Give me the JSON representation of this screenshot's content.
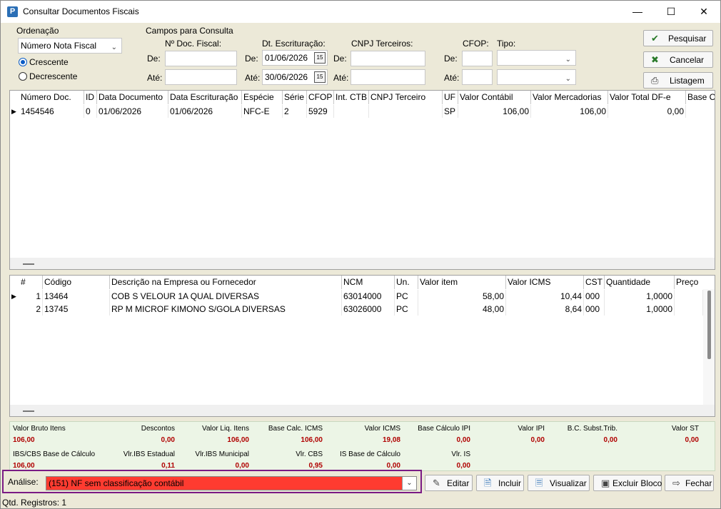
{
  "window": {
    "title": "Consultar Documentos Fiscais",
    "app_icon_letter": "P",
    "minimize": "—",
    "maximize": "☐",
    "close": "✕"
  },
  "ordenacao": {
    "label": "Ordenação",
    "selected": "Número Nota Fiscal",
    "crescente": "Crescente",
    "decrescente": "Decrescente"
  },
  "campos": {
    "title": "Campos para Consulta",
    "nro_doc_label": "Nº Doc. Fiscal:",
    "dt_escrit_label": "Dt. Escrituração:",
    "cnpj_label": "CNPJ Terceiros:",
    "cfop_label": "CFOP:",
    "tipo_label": "Tipo:",
    "de": "De:",
    "ate": "Até:",
    "dt_de_value": "01/06/2026",
    "dt_ate_value": "30/06/2026",
    "nro_de_value": "",
    "nro_ate_value": "",
    "cnpj_de_value": "",
    "cnpj_ate_value": "",
    "cfop_de_value": "",
    "cfop_ate_value": "",
    "tipo_de_value": "",
    "tipo_ate_value": ""
  },
  "actions": {
    "pesquisar": "Pesquisar",
    "cancelar": "Cancelar",
    "listagem": "Listagem"
  },
  "documents": {
    "columns": [
      "Número Doc.",
      "ID",
      "Data Documento",
      "Data Escrituração",
      "Espécie",
      "Série",
      "CFOP",
      "Int. CTB",
      "CNPJ Terceiro",
      "UF",
      "Valor Contábil",
      "Valor Mercadorias",
      "Valor Total DF-e",
      "Base C"
    ],
    "rows": [
      [
        "1454546",
        "0",
        "01/06/2026",
        "01/06/2026",
        "NFC-E",
        "2",
        "5929",
        "",
        "",
        "SP",
        "106,00",
        "106,00",
        "0,00",
        ""
      ]
    ]
  },
  "items": {
    "columns": [
      "#",
      "Código",
      "Descrição na Empresa ou Fornecedor",
      "NCM",
      "Un.",
      "Valor item",
      "Valor ICMS",
      "CST",
      "Quantidade",
      "Preço"
    ],
    "rows": [
      [
        "1",
        "13464",
        "COB S VELOUR 1A QUAL DIVERSAS",
        "63014000",
        "PC",
        "58,00",
        "10,44",
        "000",
        "1,0000",
        ""
      ],
      [
        "2",
        "13745",
        "RP M MICROF KIMONO S/GOLA DIVERSAS",
        "63026000",
        "PC",
        "48,00",
        "8,64",
        "000",
        "1,0000",
        ""
      ]
    ]
  },
  "totals": {
    "row1": [
      {
        "label": "Valor Bruto Itens",
        "value": "106,00"
      },
      {
        "label": "Descontos",
        "value": "0,00"
      },
      {
        "label": "Valor Liq. Itens",
        "value": "106,00"
      },
      {
        "label": "Base Calc. ICMS",
        "value": "106,00"
      },
      {
        "label": "Valor ICMS",
        "value": "19,08"
      },
      {
        "label": "Base Cálculo IPI",
        "value": "0,00"
      },
      {
        "label": "Valor IPI",
        "value": "0,00"
      },
      {
        "label": "B.C. Subst.Trib.",
        "value": "0,00"
      },
      {
        "label": "Valor ST",
        "value": "0,00"
      }
    ],
    "row2": [
      {
        "label": "IBS/CBS Base de Cálculo",
        "value": "106,00"
      },
      {
        "label": "Vlr.IBS Estadual",
        "value": "0,11"
      },
      {
        "label": "Vlr.IBS Municipal",
        "value": "0,00"
      },
      {
        "label": "Vlr. CBS",
        "value": "0,95"
      },
      {
        "label": "IS Base de Cálculo",
        "value": "0,00"
      },
      {
        "label": "Vlr. IS",
        "value": "0,00"
      }
    ]
  },
  "analise": {
    "label": "Análise:",
    "selected": "(151) NF sem classificação contábil",
    "highlight_color": "#ff3b30"
  },
  "bottom_buttons": {
    "editar": "Editar",
    "incluir": "Incluir",
    "visualizar": "Visualizar",
    "excluir_bloco": "Excluir Bloco",
    "fechar": "Fechar"
  },
  "status": {
    "qtd_registros": "Qtd. Registros: 1"
  }
}
